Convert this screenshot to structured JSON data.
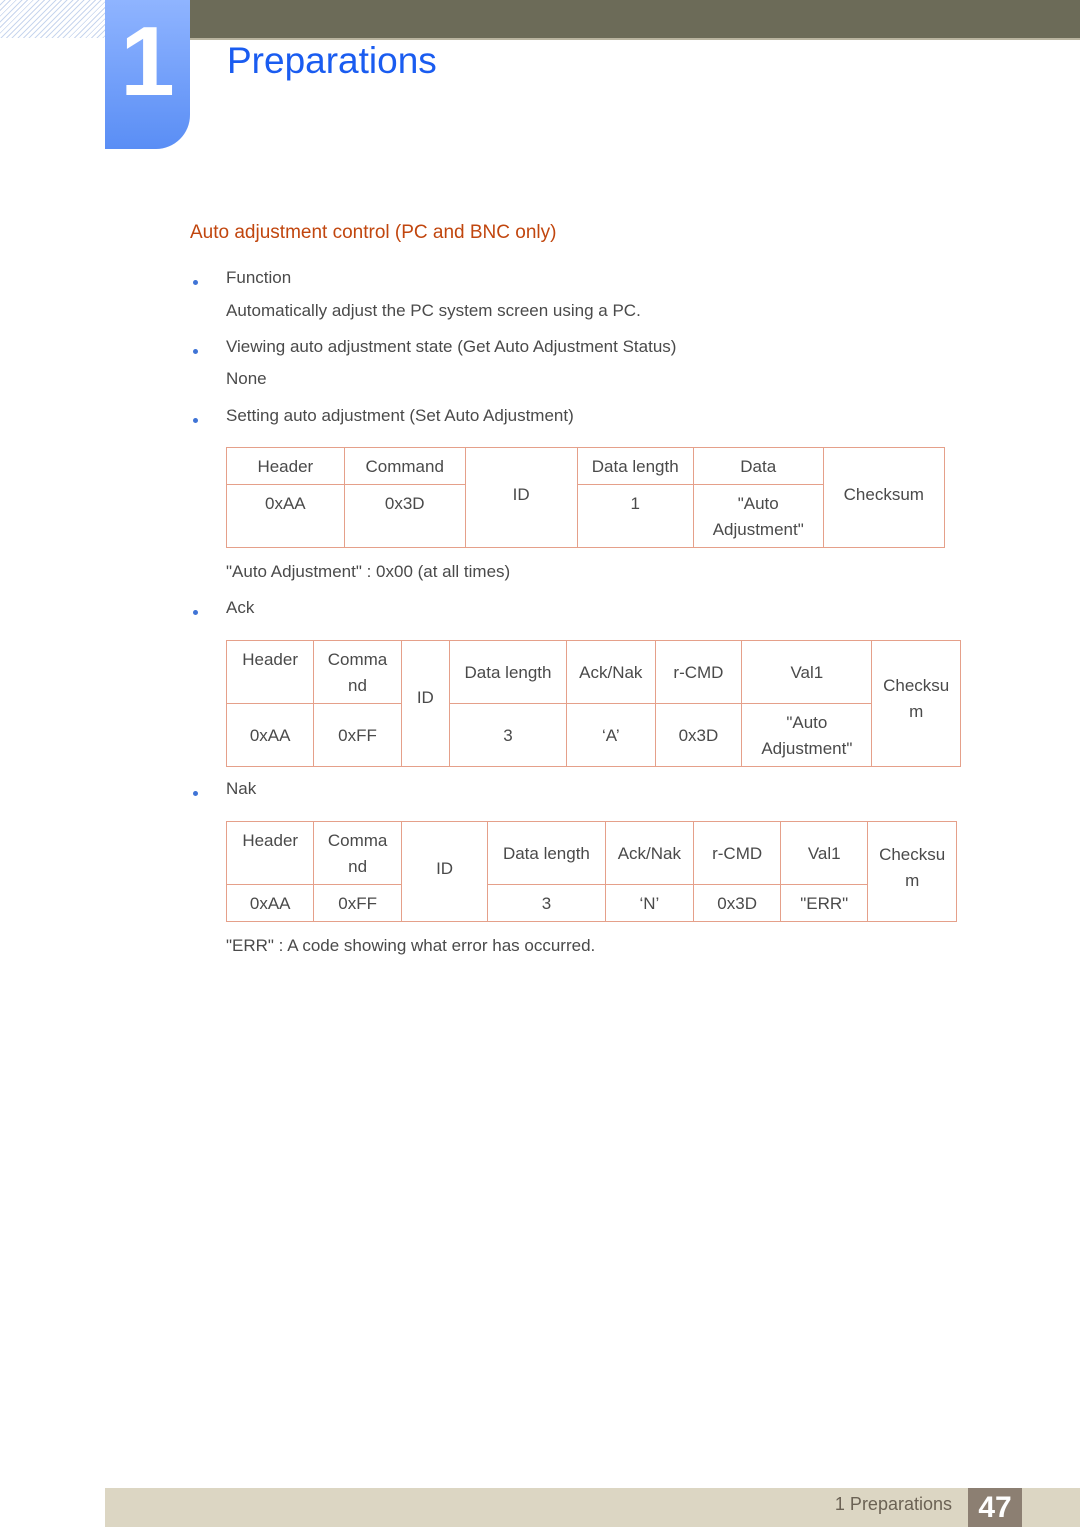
{
  "chapter": {
    "number": "1",
    "title": "Preparations"
  },
  "section": {
    "title": "Auto adjustment control (PC and BNC only)"
  },
  "items": [
    {
      "label": "Function",
      "detail": "Automatically adjust the PC system screen using a PC."
    },
    {
      "label": "Viewing auto adjustment state (Get Auto Adjustment Status)",
      "detail": "None"
    },
    {
      "label": "Setting auto adjustment (Set Auto Adjustment)"
    },
    {
      "label": "Ack"
    },
    {
      "label": "Nak"
    }
  ],
  "set_table": {
    "headers": [
      "Header",
      "Command",
      "ID",
      "Data length",
      "Data",
      "Checksum"
    ],
    "values": [
      "0xAA",
      "0x3D",
      "1",
      "\"Auto Adjustment\""
    ]
  },
  "set_note": "\"Auto Adjustment\" : 0x00 (at all times)",
  "ack_table": {
    "headers": [
      "Header",
      "Comma nd",
      "ID",
      "Data length",
      "Ack/Nak",
      "r-CMD",
      "Val1",
      "Checksu m"
    ],
    "values": [
      "0xAA",
      "0xFF",
      "3",
      "‘A’",
      "0x3D",
      "\"Auto Adjustment\""
    ]
  },
  "nak_table": {
    "headers": [
      "Header",
      "Comma nd",
      "ID",
      "Data length",
      "Ack/Nak",
      "r-CMD",
      "Val1",
      "Checksu m"
    ],
    "values": [
      "0xAA",
      "0xFF",
      "3",
      "‘N’",
      "0x3D",
      "\"ERR\""
    ]
  },
  "nak_note": "\"ERR\" : A code showing what error has occurred.",
  "footer": {
    "label": "1 Preparations",
    "page": "47"
  },
  "colors": {
    "title_blue": "#1a5cf0",
    "section_orange": "#c1460e",
    "bullet_blue": "#3f74d6",
    "topbar": "#6c6b58",
    "footer": "#dcd6c3",
    "page_box": "#8c7f72"
  }
}
